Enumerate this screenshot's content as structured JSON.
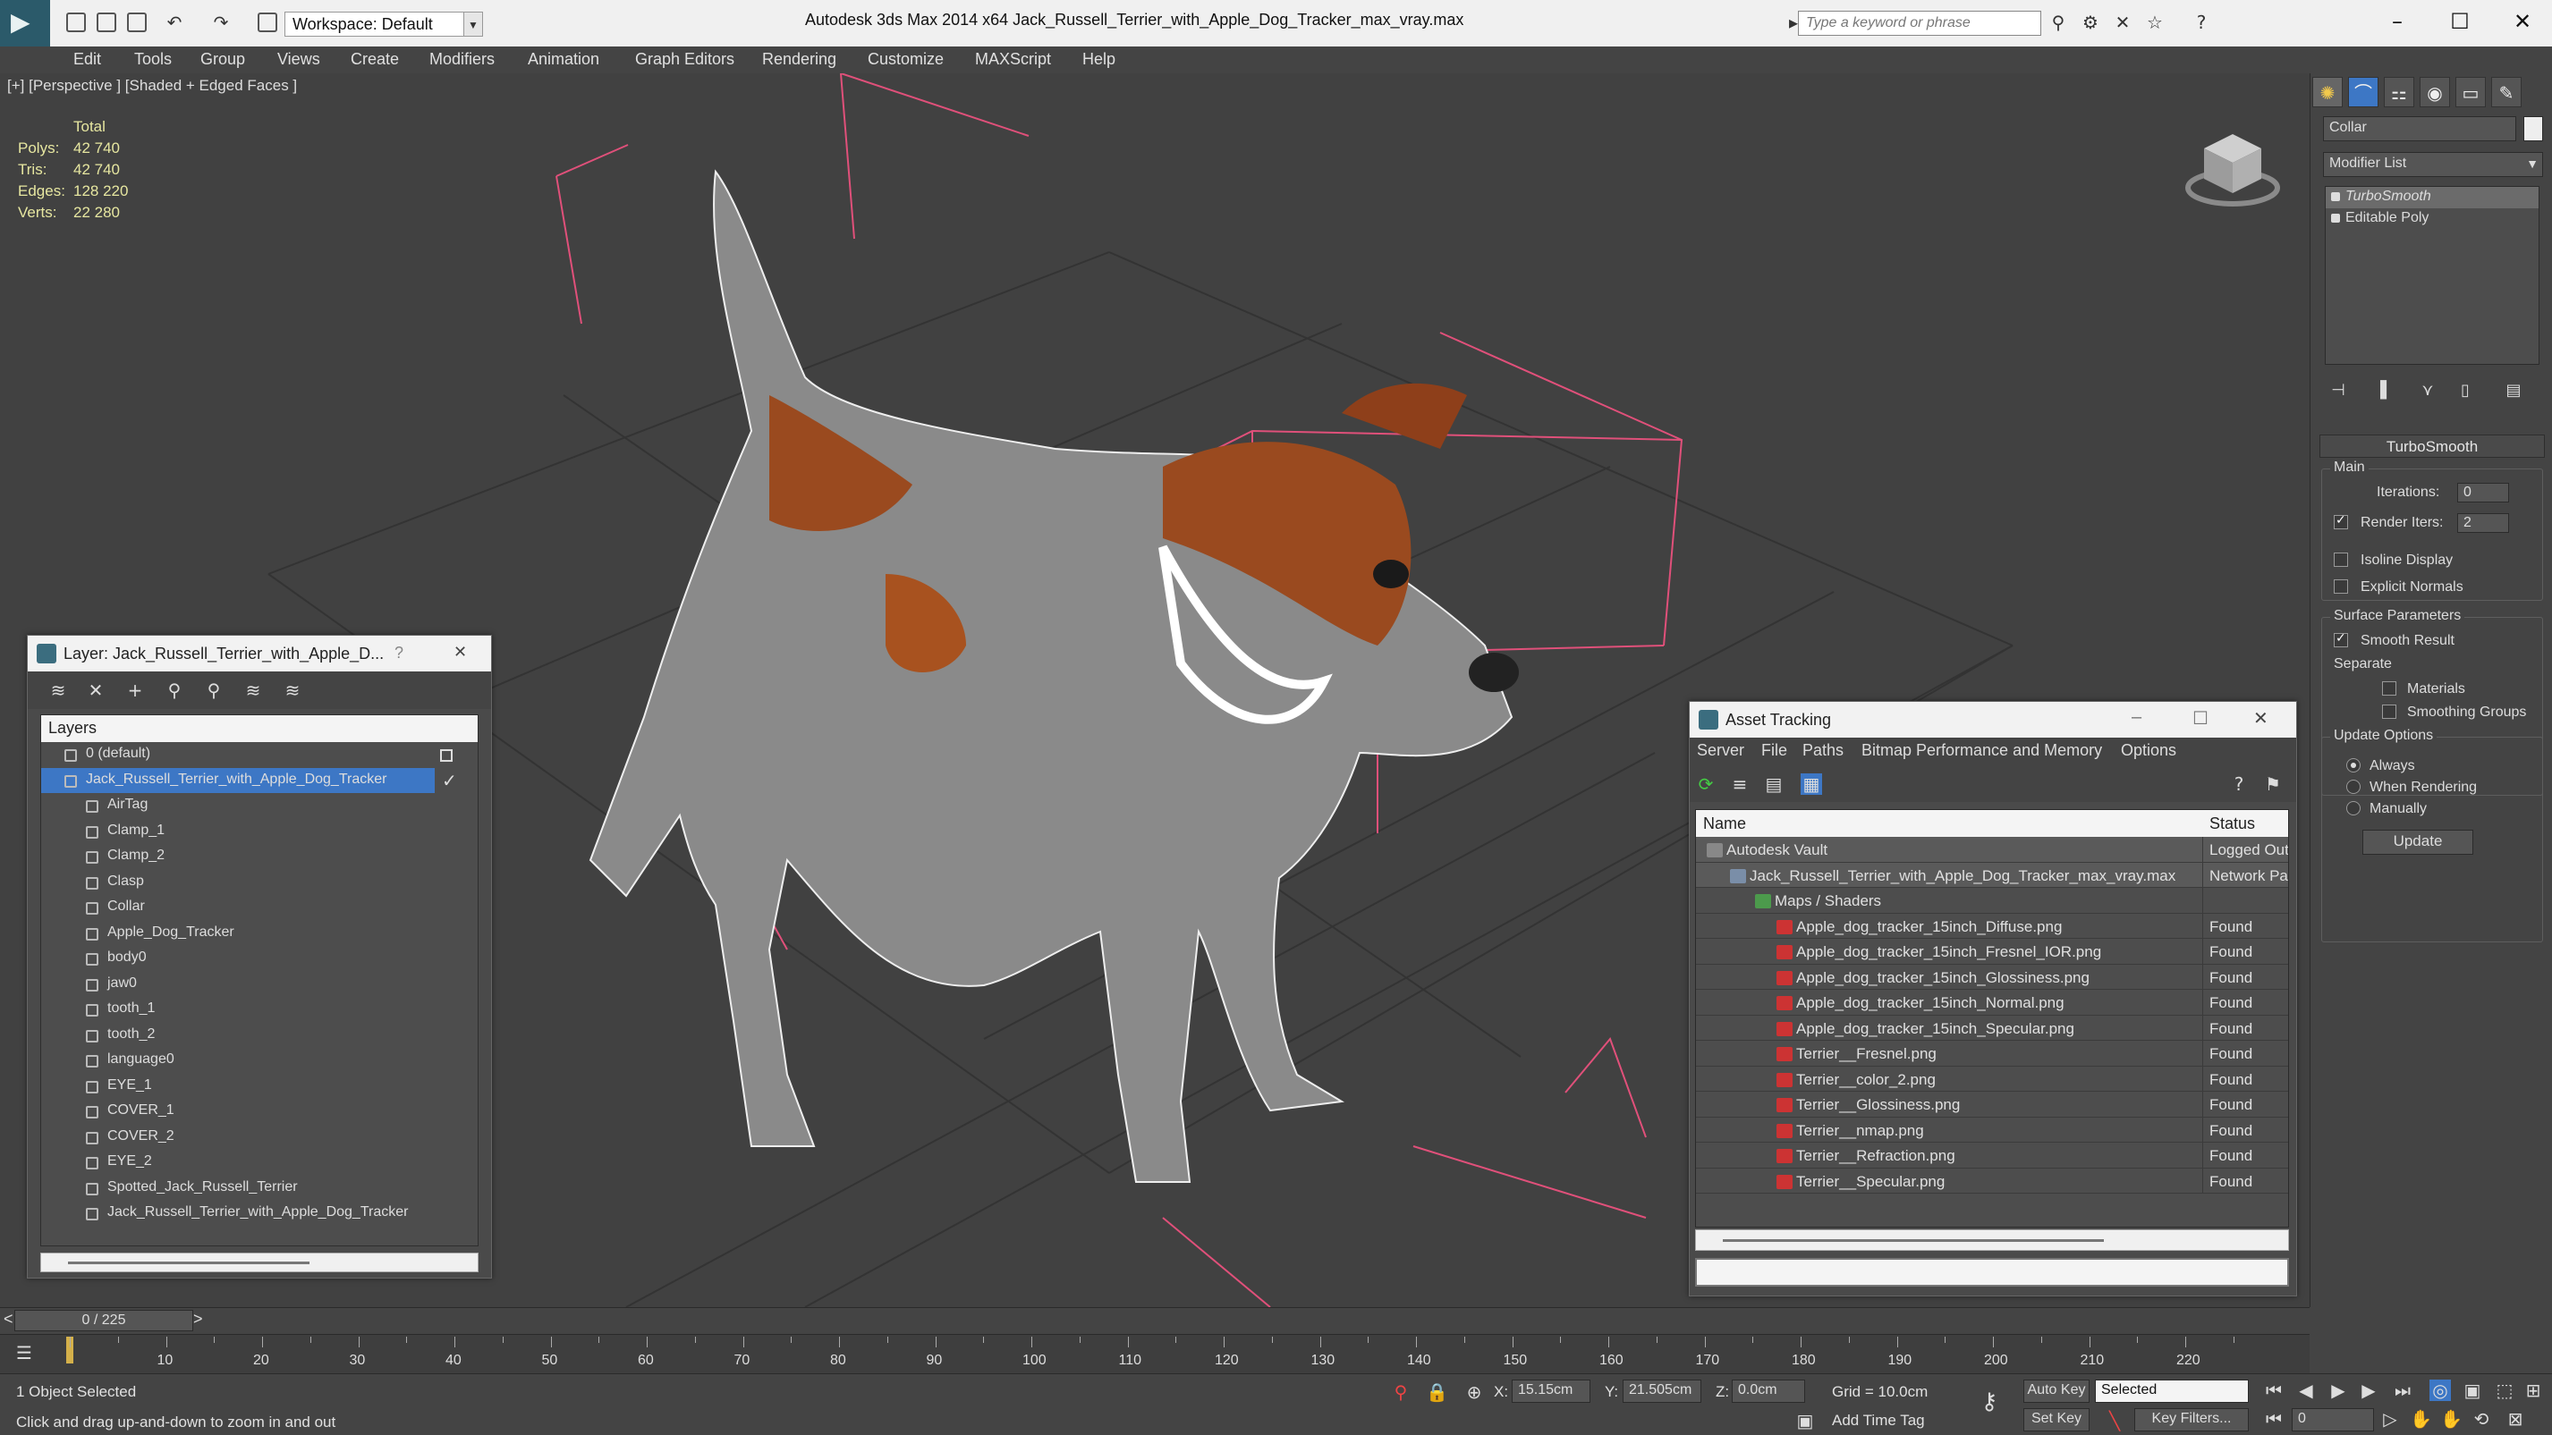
{
  "app": {
    "title": "Autodesk 3ds Max  2014 x64    Jack_Russell_Terrier_with_Apple_Dog_Tracker_max_vray.max",
    "workspace": "Workspace: Default",
    "search_placeholder": "Type a keyword or phrase"
  },
  "menu": [
    "Edit",
    "Tools",
    "Group",
    "Views",
    "Create",
    "Modifiers",
    "Animation",
    "Graph Editors",
    "Rendering",
    "Customize",
    "MAXScript",
    "Help"
  ],
  "viewport": {
    "label": "[+] [Perspective ] [Shaded + Edged Faces ]",
    "stats_title": "Total",
    "stats": [
      {
        "k": "Polys:",
        "v": "42 740"
      },
      {
        "k": "Tris:",
        "v": "42 740"
      },
      {
        "k": "Edges:",
        "v": "128 220"
      },
      {
        "k": "Verts:",
        "v": "22 280"
      }
    ]
  },
  "layer_window": {
    "title": "Layer: Jack_Russell_Terrier_with_Apple_D...",
    "help": "?",
    "close": "✕",
    "header": "Layers",
    "rows": [
      {
        "label": "0 (default)",
        "level": 1,
        "selected": false
      },
      {
        "label": "Jack_Russell_Terrier_with_Apple_Dog_Tracker",
        "level": 1,
        "selected": true
      },
      {
        "label": "AirTag",
        "level": 2,
        "selected": false
      },
      {
        "label": "Clamp_1",
        "level": 2,
        "selected": false
      },
      {
        "label": "Clamp_2",
        "level": 2,
        "selected": false
      },
      {
        "label": "Clasp",
        "level": 2,
        "selected": false
      },
      {
        "label": "Collar",
        "level": 2,
        "selected": false
      },
      {
        "label": "Apple_Dog_Tracker",
        "level": 2,
        "selected": false
      },
      {
        "label": "body0",
        "level": 2,
        "selected": false
      },
      {
        "label": "jaw0",
        "level": 2,
        "selected": false
      },
      {
        "label": "tooth_1",
        "level": 2,
        "selected": false
      },
      {
        "label": "tooth_2",
        "level": 2,
        "selected": false
      },
      {
        "label": "language0",
        "level": 2,
        "selected": false
      },
      {
        "label": "EYE_1",
        "level": 2,
        "selected": false
      },
      {
        "label": "COVER_1",
        "level": 2,
        "selected": false
      },
      {
        "label": "COVER_2",
        "level": 2,
        "selected": false
      },
      {
        "label": "EYE_2",
        "level": 2,
        "selected": false
      },
      {
        "label": "Spotted_Jack_Russell_Terrier",
        "level": 2,
        "selected": false
      },
      {
        "label": "Jack_Russell_Terrier_with_Apple_Dog_Tracker",
        "level": 2,
        "selected": false
      }
    ]
  },
  "asset_window": {
    "title": "Asset Tracking",
    "menu": [
      "Server",
      "File",
      "Paths",
      "Bitmap Performance and Memory",
      "Options"
    ],
    "col_name": "Name",
    "col_status": "Status",
    "rows": [
      {
        "name": "Autodesk Vault",
        "status": "Logged Out",
        "level": 1
      },
      {
        "name": "Jack_Russell_Terrier_with_Apple_Dog_Tracker_max_vray.max",
        "status": "Network Pa",
        "level": 2
      },
      {
        "name": "Maps / Shaders",
        "status": "",
        "level": 3
      },
      {
        "name": "Apple_dog_tracker_15inch_Diffuse.png",
        "status": "Found",
        "level": 4
      },
      {
        "name": "Apple_dog_tracker_15inch_Fresnel_IOR.png",
        "status": "Found",
        "level": 4
      },
      {
        "name": "Apple_dog_tracker_15inch_Glossiness.png",
        "status": "Found",
        "level": 4
      },
      {
        "name": "Apple_dog_tracker_15inch_Normal.png",
        "status": "Found",
        "level": 4
      },
      {
        "name": "Apple_dog_tracker_15inch_Specular.png",
        "status": "Found",
        "level": 4
      },
      {
        "name": "Terrier__Fresnel.png",
        "status": "Found",
        "level": 4
      },
      {
        "name": "Terrier__color_2.png",
        "status": "Found",
        "level": 4
      },
      {
        "name": "Terrier__Glossiness.png",
        "status": "Found",
        "level": 4
      },
      {
        "name": "Terrier__nmap.png",
        "status": "Found",
        "level": 4
      },
      {
        "name": "Terrier__Refraction.png",
        "status": "Found",
        "level": 4
      },
      {
        "name": "Terrier__Specular.png",
        "status": "Found",
        "level": 4
      }
    ]
  },
  "command_panel": {
    "object_name": "Collar",
    "modifier_list": "Modifier List",
    "stack": [
      "TurboSmooth",
      "Editable Poly"
    ],
    "rollout_title": "TurboSmooth",
    "main_group": "Main",
    "iterations_label": "Iterations:",
    "iterations": "0",
    "render_iters_label": "Render Iters:",
    "render_iters": "2",
    "isoline": "Isoline Display",
    "explicit_normals": "Explicit Normals",
    "surface_group": "Surface Parameters",
    "smooth_result": "Smooth Result",
    "separate": "Separate",
    "materials": "Materials",
    "smoothing_groups": "Smoothing Groups",
    "update_group": "Update Options",
    "always": "Always",
    "when_rendering": "When Rendering",
    "manually": "Manually",
    "update_btn": "Update"
  },
  "timeline": {
    "slider": "0 / 225",
    "ticks": [
      "10",
      "20",
      "30",
      "40",
      "50",
      "60",
      "70",
      "80",
      "90",
      "100",
      "110",
      "120",
      "130",
      "140",
      "150",
      "160",
      "170",
      "180",
      "190",
      "200",
      "210",
      "220"
    ]
  },
  "status": {
    "selected": "1 Object Selected",
    "hint": "Click and drag up-and-down to zoom in and out",
    "x_label": "X:",
    "x": "15.15cm",
    "y_label": "Y:",
    "y": "21.505cm",
    "z_label": "Z:",
    "z": "0.0cm",
    "grid": "Grid = 10.0cm",
    "auto_key": "Auto Key",
    "set_key": "Set Key",
    "selected_dropdown": "Selected",
    "key_filters": "Key Filters...",
    "add_time_tag": "Add Time Tag",
    "frame": "0"
  },
  "colors": {
    "selection_blue": "#3d77c5",
    "helper_pink": "#e0507a",
    "stats_yellow": "#e6e6a0"
  }
}
